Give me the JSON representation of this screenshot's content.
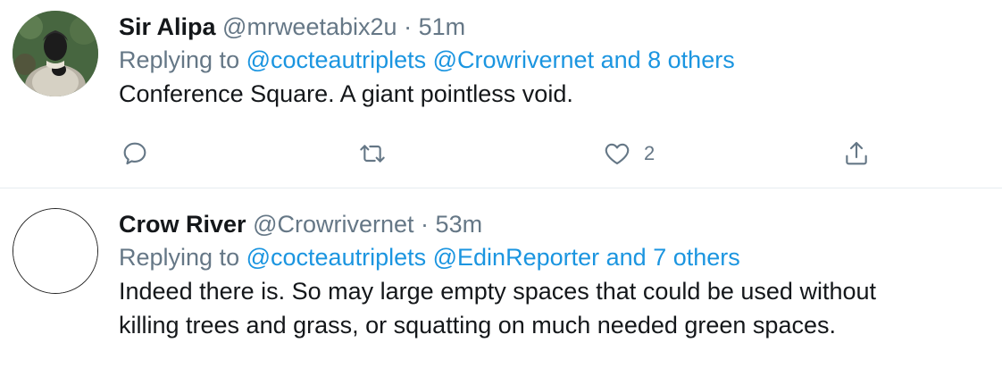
{
  "tweets": [
    {
      "name": "Sir Alipa",
      "handle": "@mrweetabix2u",
      "separator": "·",
      "time": "51m",
      "replying_prefix": "Replying to",
      "replying_mentions": [
        "@cocteautriplets",
        "@Crowrivernet"
      ],
      "replying_others": "and 8 others",
      "text": "Conference Square. A giant pointless void.",
      "avatar_icon": "statue-avatar-photo",
      "actions": {
        "reply_icon": "reply-icon",
        "retweet_icon": "retweet-icon",
        "like_icon": "heart-icon",
        "like_count": "2",
        "share_icon": "share-icon"
      }
    },
    {
      "name": "Crow River",
      "handle": "@Crowrivernet",
      "separator": "·",
      "time": "53m",
      "replying_prefix": "Replying to",
      "replying_mentions": [
        "@cocteautriplets",
        "@EdinReporter"
      ],
      "replying_others": "and 7 others",
      "text_lines": [
        "Indeed there is. So may large empty spaces that could be used without",
        "killing trees and grass, or squatting on much needed green spaces."
      ],
      "avatar_icon": "empty-circle-avatar"
    }
  ],
  "colors": {
    "link": "#1b95e0",
    "muted": "#657786",
    "text": "#14171a",
    "divider": "#e6ecf0"
  }
}
